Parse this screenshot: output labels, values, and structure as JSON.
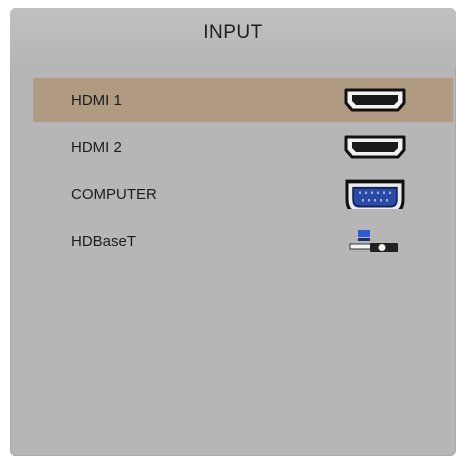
{
  "menu": {
    "title": "INPUT",
    "items": [
      {
        "label": "HDMI 1",
        "icon": "hdmi-port-icon",
        "selected": true
      },
      {
        "label": "HDMI 2",
        "icon": "hdmi-port-icon",
        "selected": false
      },
      {
        "label": "COMPUTER",
        "icon": "vga-port-icon",
        "selected": false
      },
      {
        "label": "HDBaseT",
        "icon": "hdbaset-port-icon",
        "selected": false
      }
    ]
  },
  "colors": {
    "panel_background": "#b6b6b6",
    "selection_highlight": "#b09a82",
    "vga_accent": "#2b4aa3"
  }
}
